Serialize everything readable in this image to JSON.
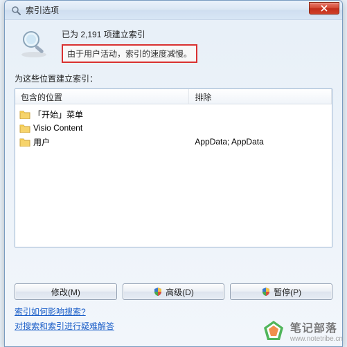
{
  "window": {
    "title": "索引选项"
  },
  "header": {
    "line1": "已为 2,191 项建立索引",
    "line2": "由于用户活动，索引的速度减慢。"
  },
  "subhead": "为这些位置建立索引：",
  "columns": {
    "included": "包含的位置",
    "excluded": "排除"
  },
  "rows": [
    {
      "name": "「开始」菜单",
      "exclude": ""
    },
    {
      "name": "Visio Content",
      "exclude": ""
    },
    {
      "name": "用户",
      "exclude": "AppData; AppData"
    }
  ],
  "buttons": {
    "modify": "修改(M)",
    "advanced": "高级(D)",
    "pause": "暂停(P)"
  },
  "links": {
    "howAffect": "索引如何影响搜索?",
    "troubleshoot": "对搜索和索引进行疑难解答"
  },
  "watermark": {
    "title": "笔记部落",
    "url": "www.notetribe.cn"
  }
}
